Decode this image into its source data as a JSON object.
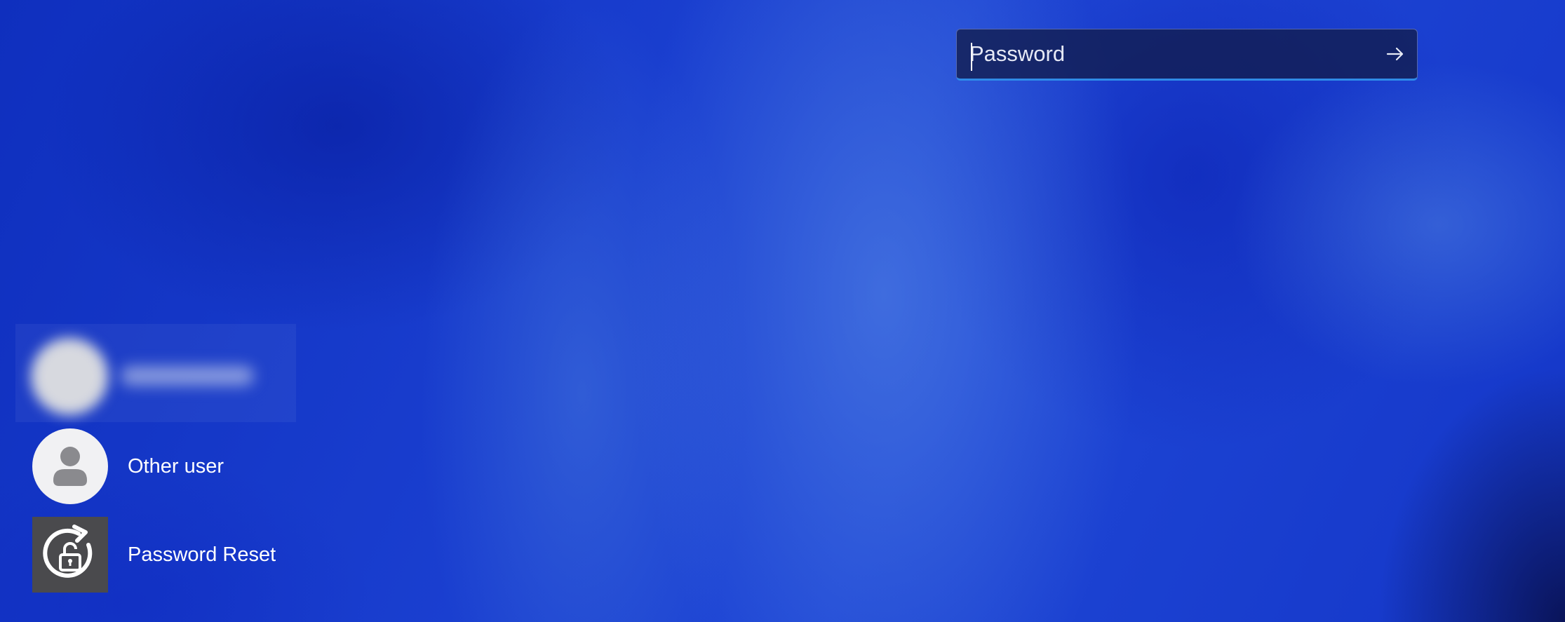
{
  "password_field": {
    "placeholder": "Password",
    "value": "",
    "submit_icon": "arrow-right-icon",
    "accent_color": "#2f8be8"
  },
  "users": {
    "blurred_user": {
      "name": "",
      "avatar_icon": "avatar-blurred"
    },
    "other_user": {
      "label": "Other user",
      "avatar_icon": "person-icon"
    },
    "password_reset": {
      "label": "Password Reset",
      "icon": "lock-reset-icon"
    }
  },
  "colors": {
    "background": "#1236c4",
    "text": "#ffffff"
  }
}
